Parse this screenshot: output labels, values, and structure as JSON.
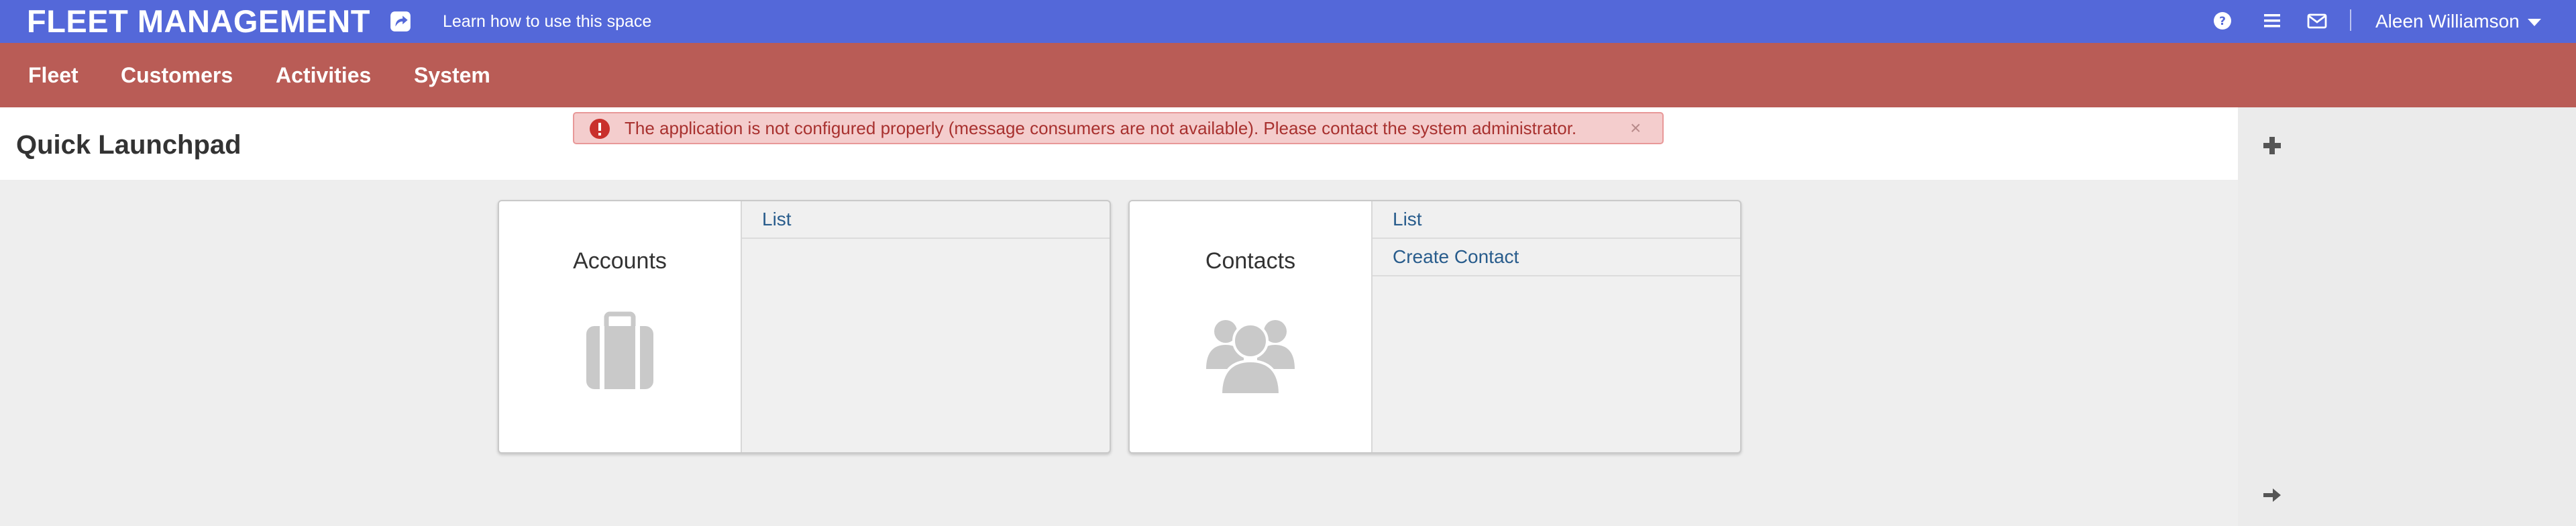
{
  "header": {
    "brand": "FLEET MANAGEMENT",
    "learn_link": "Learn how to use this space",
    "user_name": "Aleen Williamson",
    "brand_color": "#5468d9"
  },
  "nav": {
    "items": [
      {
        "label": "Fleet"
      },
      {
        "label": "Customers"
      },
      {
        "label": "Activities"
      },
      {
        "label": "System"
      }
    ],
    "color": "#b95c56"
  },
  "alert": {
    "message": "The application is not configured properly (message consumers are not available). Please contact the system administrator.",
    "close": "×"
  },
  "page": {
    "title": "Quick Launchpad"
  },
  "cards": [
    {
      "title": "Accounts",
      "icon": "briefcase-icon",
      "links": [
        "List"
      ]
    },
    {
      "title": "Contacts",
      "icon": "users-icon",
      "links": [
        "List",
        "Create Contact"
      ]
    }
  ],
  "sidebar": {
    "icons": [
      "plus-icon",
      "arrow-right-icon"
    ]
  }
}
